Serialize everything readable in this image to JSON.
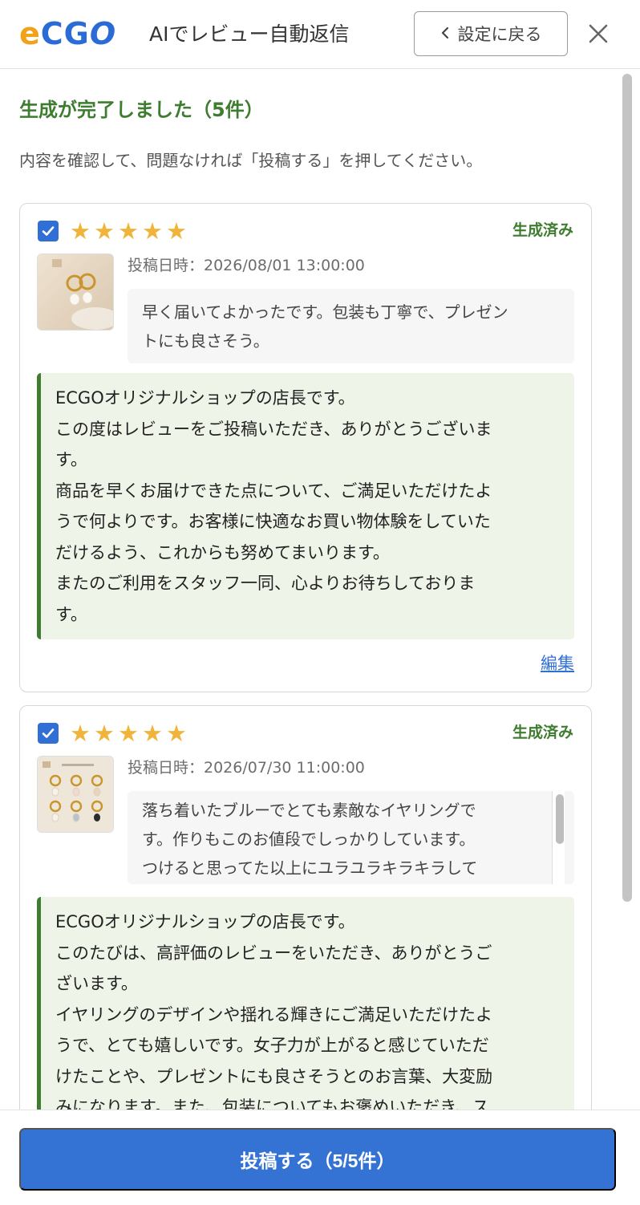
{
  "header": {
    "logo_parts": [
      "e",
      "C",
      "G",
      "O"
    ],
    "logo_text": "ECGO",
    "title": "AIでレビュー自動返信",
    "back_label": "設定に戻る"
  },
  "summary": {
    "title": "生成が完了しました（5件）",
    "description": "内容を確認して、問題なければ「投稿する」を押してください。"
  },
  "reviews": [
    {
      "stars": [
        "★",
        "★",
        "★",
        "★",
        "★"
      ],
      "status": "生成済み",
      "posted_at": "投稿日時：2026/08/01 13:00:00",
      "review_lines": [
        "早く届いてよかったです。包装も丁寧で、プレゼン",
        "トにも良さそう。"
      ],
      "reply_lines": [
        "ECGOオリジナルショップの店長です。",
        "この度はレビューをご投稿いただき、ありがとうございま",
        "す。",
        "商品を早くお届けできた点について、ご満足いただけたよ",
        "うで何よりです。お客様に快適なお買い物体験をしていた",
        "だけるよう、これからも努めてまいります。",
        "またのご利用をスタッフ一同、心よりお待ちしておりま",
        "す。"
      ],
      "edit_label": "編集"
    },
    {
      "stars": [
        "★",
        "★",
        "★",
        "★",
        "★"
      ],
      "status": "生成済み",
      "posted_at": "投稿日時：2026/07/30 11:00:00",
      "review_lines": [
        "落ち着いたブルーでとても素敵なイヤリングで",
        "す。作りもこのお値段でしっかりしています。",
        "つけると思ってた以上にユラユラキラキラして"
      ],
      "reply_lines": [
        "ECGOオリジナルショップの店長です。",
        "このたびは、高評価のレビューをいただき、ありがとうご",
        "ざいます。",
        "イヤリングのデザインや揺れる輝きにご満足いただけたよ",
        "うで、とても嬉しいです。女子力が上がると感じていただ",
        "けたことや、プレゼントにも良さそうとのお言葉、大変励",
        "みになります。また、包装についてもお褒めいただき、ス"
      ]
    }
  ],
  "footer": {
    "submit_label": "投稿する（5/5件）"
  },
  "colors": {
    "accent_blue": "#3472d4",
    "success_green": "#3e7d2f",
    "star_gold": "#f0b43a",
    "logo_orange": "#f0a21a"
  },
  "icons": [
    "chevron-left-icon",
    "close-icon",
    "check-icon",
    "star-icon",
    "product-thumbnail-image"
  ]
}
